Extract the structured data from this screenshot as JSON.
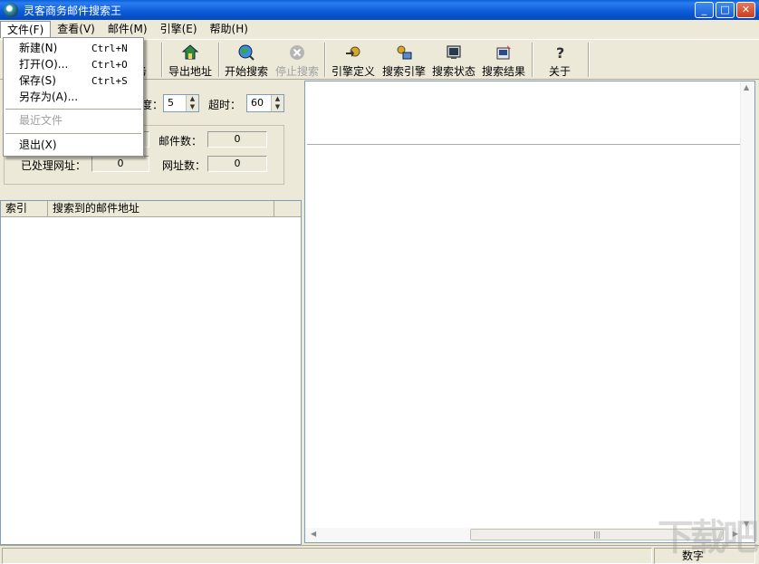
{
  "window": {
    "title": "灵客商务邮件搜索王",
    "minimize": "_",
    "maximize": "□",
    "close": "✕"
  },
  "menubar": {
    "items": [
      "文件(F)",
      "查看(V)",
      "邮件(M)",
      "引擎(E)",
      "帮助(H)"
    ]
  },
  "file_menu": {
    "new": {
      "label": "新建(N)",
      "shortcut": "Ctrl+N"
    },
    "open": {
      "label": "打开(O)...",
      "shortcut": "Ctrl+O"
    },
    "save": {
      "label": "保存(S)",
      "shortcut": "Ctrl+S"
    },
    "save_as": {
      "label": "另存为(A)..."
    },
    "recent": {
      "label": "最近文件"
    },
    "exit": {
      "label": "退出(X)"
    }
  },
  "toolbar": {
    "task_partial": "务",
    "export": "导出地址",
    "start": "开始搜索",
    "stop": "停止搜索",
    "engine_def": "引擎定义",
    "search_engine": "搜索引擎",
    "search_status": "搜索状态",
    "search_results": "搜索结果",
    "about": "关于"
  },
  "settings": {
    "depth_label_partial": "度：",
    "depth_value": "5",
    "timeout_label": "超时：",
    "timeout_value": "60"
  },
  "stats": {
    "mail_count_label": "邮件数：",
    "mail_count": "0",
    "processed_label": "已处理网址：",
    "processed": "0",
    "url_count_label": "网址数：",
    "url_count": "0"
  },
  "list": {
    "columns": [
      "索引",
      "搜索到的邮件地址"
    ]
  },
  "statusbar": {
    "mode": "数字"
  },
  "icons": {
    "export": "house-arrow-icon",
    "start": "globe-search-icon",
    "stop": "stop-circle-icon",
    "engine_def": "gear-arrow-icon",
    "search_engine": "gears-icon",
    "search_status": "monitor-icon",
    "search_results": "results-icon",
    "about": "question-icon"
  },
  "watermark": "下载吧"
}
